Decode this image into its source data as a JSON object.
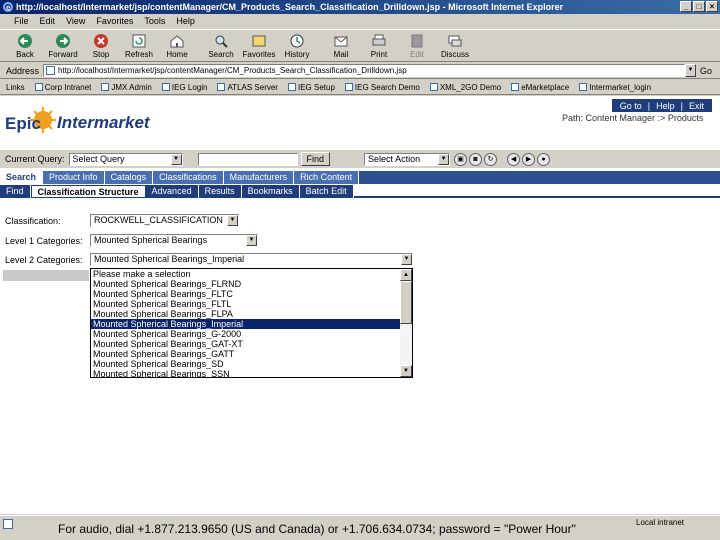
{
  "window": {
    "title": "http://localhost/Intermarket/jsp/contentManager/CM_Products_Search_Classification_Drilldown.jsp - Microsoft Internet Explorer",
    "controls": [
      "_",
      "□",
      "×"
    ]
  },
  "menu": [
    "File",
    "Edit",
    "View",
    "Favorites",
    "Tools",
    "Help"
  ],
  "toolbar": [
    {
      "label": "Back",
      "icon": "back-arrow-icon"
    },
    {
      "label": "Forward",
      "icon": "forward-arrow-icon"
    },
    {
      "label": "Stop",
      "icon": "stop-icon"
    },
    {
      "label": "Refresh",
      "icon": "refresh-icon"
    },
    {
      "label": "Home",
      "icon": "home-icon"
    },
    {
      "label": "Search",
      "icon": "search-icon"
    },
    {
      "label": "Favorites",
      "icon": "favorites-icon"
    },
    {
      "label": "History",
      "icon": "history-icon"
    },
    {
      "label": "Mail",
      "icon": "mail-icon"
    },
    {
      "label": "Print",
      "icon": "print-icon"
    },
    {
      "label": "Edit",
      "icon": "edit-icon",
      "disabled": true
    },
    {
      "label": "Discuss",
      "icon": "discuss-icon"
    }
  ],
  "address": {
    "label": "Address",
    "value": "http://localhost/Intermarket/jsp/contentManager/CM_Products_Search_Classification_Drilldown.jsp",
    "go": "Go"
  },
  "links": {
    "label": "Links",
    "items": [
      "Corp Intranet",
      "JMX Admin",
      "IEG Login",
      "ATLAS Server",
      "IEG Setup",
      "IEG Search Demo",
      "XML_2GO Demo",
      "eMarketplace",
      "Intermarket_login"
    ]
  },
  "page": {
    "logo_text_1": "Epic",
    "logo_text_2": "Intermarket",
    "top_links": [
      "Go to",
      "|",
      "Help",
      "|",
      "Exit"
    ],
    "path": "Path: Content Manager :> Products",
    "query_label": "Current Query:",
    "query_select": "Select Query",
    "find_button": "Find",
    "action_select": "Select Action"
  },
  "tabs_primary": [
    {
      "label": "Search",
      "active": true
    },
    {
      "label": "Product Info",
      "active": false
    },
    {
      "label": "Catalogs",
      "active": false
    },
    {
      "label": "Classifications",
      "active": false
    },
    {
      "label": "Manufacturers",
      "active": false
    },
    {
      "label": "Rich Content",
      "active": false
    }
  ],
  "tabs_secondary": [
    {
      "label": "Find",
      "active": false
    },
    {
      "label": "Classification Structure",
      "active": true
    },
    {
      "label": "Advanced",
      "active": false
    },
    {
      "label": "Results",
      "active": false
    },
    {
      "label": "Bookmarks",
      "active": false
    },
    {
      "label": "Batch Edit",
      "active": false
    }
  ],
  "form": {
    "classification_label": "Classification:",
    "classification_value": "ROCKWELL_CLASSIFICATION",
    "level1_label": "Level 1 Categories:",
    "level1_value": "Mounted Spherical Bearings",
    "level2_label": "Level 2 Categories:",
    "level2_value": "Mounted Spherical Bearings_Imperial"
  },
  "listbox": {
    "items": [
      "Please make a selection",
      "Mounted Spherical Bearings_FLRND",
      "Mounted Spherical Bearings_FLTC",
      "Mounted Spherical Bearings_FLTL",
      "Mounted Spherical Bearings_FLPA",
      "Mounted Spherical Bearings_Imperial",
      "Mounted Spherical Bearings_G-2000",
      "Mounted Spherical Bearings_GAT-XT",
      "Mounted Spherical Bearings_GATT",
      "Mounted Spherical Bearings_SD",
      "Mounted Spherical Bearings_SSN"
    ],
    "selected_index": 5
  },
  "status": {
    "zone": "Local intranet",
    "caption": "For audio, dial +1.877.213.9650 (US and Canada) or +1.706.634.0734; password = \"Power Hour\""
  }
}
